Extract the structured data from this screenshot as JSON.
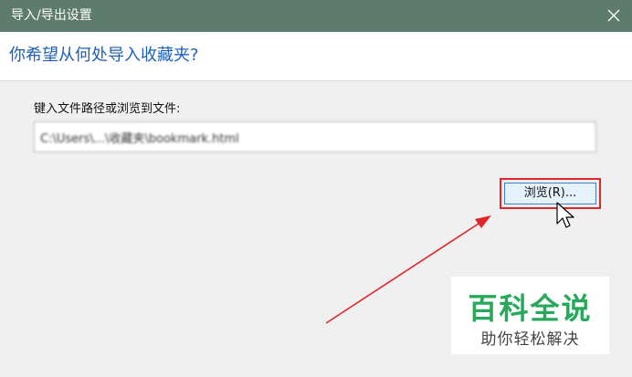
{
  "window": {
    "title": "导入/导出设置",
    "close_icon": "close-icon"
  },
  "header": {
    "question": "你希望从何处导入收藏夹?"
  },
  "form": {
    "prompt": "键入文件路径或浏览到文件:",
    "path_value": "C:\\Users\\...\\收藏夹\\bookmark.html",
    "browse_label": "浏览(R)..."
  },
  "annotations": {
    "highlight_color": "#e0262b",
    "arrow_color": "#e0262b"
  },
  "watermark": {
    "title": "百科全说",
    "subtitle": "助你轻松解决",
    "color": "#27a85a"
  }
}
